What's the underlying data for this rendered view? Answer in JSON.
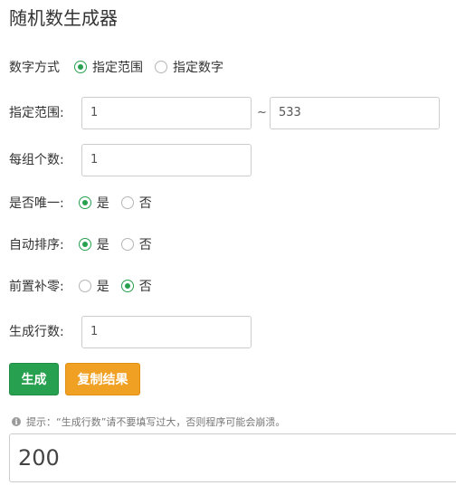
{
  "title": "随机数生成器",
  "mode": {
    "label": "数字方式",
    "options": [
      "指定范围",
      "指定数字"
    ],
    "selected": "指定范围"
  },
  "range": {
    "label": "指定范围:",
    "min": "1",
    "separator": "~",
    "max": "533"
  },
  "per_group": {
    "label": "每组个数:",
    "value": "1"
  },
  "unique": {
    "label": "是否唯一:",
    "options": [
      "是",
      "否"
    ],
    "selected": "是"
  },
  "auto_sort": {
    "label": "自动排序:",
    "options": [
      "是",
      "否"
    ],
    "selected": "是"
  },
  "leading_zero": {
    "label": "前置补零:",
    "options": [
      "是",
      "否"
    ],
    "selected": "否"
  },
  "rows": {
    "label": "生成行数:",
    "value": "1"
  },
  "buttons": {
    "generate": "生成",
    "copy": "复制结果"
  },
  "hint": {
    "icon": "info-icon",
    "text": "提示：“生成行数”请不要填写过大，否则程序可能会崩溃。"
  },
  "result": {
    "value": "200"
  },
  "colors": {
    "accent_green": "#27a04f",
    "accent_orange": "#f0a023"
  }
}
